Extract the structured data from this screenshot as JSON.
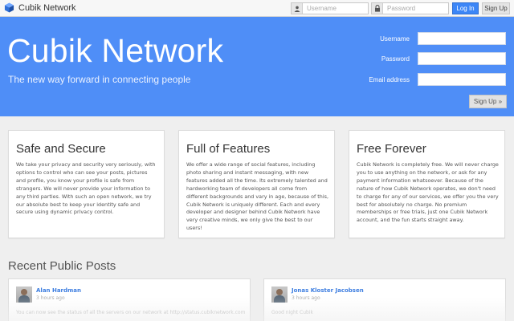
{
  "navbar": {
    "brand": "Cubik Network",
    "username_placeholder": "Username",
    "password_placeholder": "Password",
    "login_label": "Log In",
    "signup_label": "Sign Up"
  },
  "hero": {
    "title": "Cubik Network",
    "tagline": "The new way forward in connecting people",
    "form": {
      "username_label": "Username",
      "password_label": "Password",
      "email_label": "Email address",
      "submit_label": "Sign Up »"
    }
  },
  "features": [
    {
      "title": "Safe and Secure",
      "body": "We take your privacy and security very seriously, with options to control who can see your posts, pictures and profile, you know your profile is safe from strangers. We will never provide your information to any third parties. With such an open network, we try our absolute best to keep your identity safe and secure using dynamic privacy control."
    },
    {
      "title": "Full of Features",
      "body": "We offer a wide range of social features, including photo sharing and instant messaging, with new features added all the time. Its extremely talented and hardworking team of developers all come from different backgrounds and vary in age, because of this, Cubik Network is uniquely different. Each and every developer and designer behind Cubik Network have very creative minds, we only give the best to our users!"
    },
    {
      "title": "Free Forever",
      "body": "Cubik Network is completely free. We will never charge you to use anything on the network, or ask for any payment information whatsoever. Because of the nature of how Cubik Network operates, we don't need to charge for any of our services, we offer you the very best for absolutely no charge. No premium memberships or free trials, just one Cubik Network account, and the fun starts straight away."
    }
  ],
  "recent": {
    "title": "Recent Public Posts",
    "posts": [
      {
        "author": "Alan Hardman",
        "time": "3 hours ago",
        "snippet": "You can now see the status of all the servers on our network at http://status.cubiknetwork.com"
      },
      {
        "author": "Jonas Kloster Jacobsen",
        "time": "3 hours ago",
        "snippet": "Good night Cubik"
      }
    ]
  },
  "colors": {
    "hero_blue": "#4f8ef7",
    "login_blue": "#3c86f7",
    "link_blue": "#3c7de0"
  }
}
